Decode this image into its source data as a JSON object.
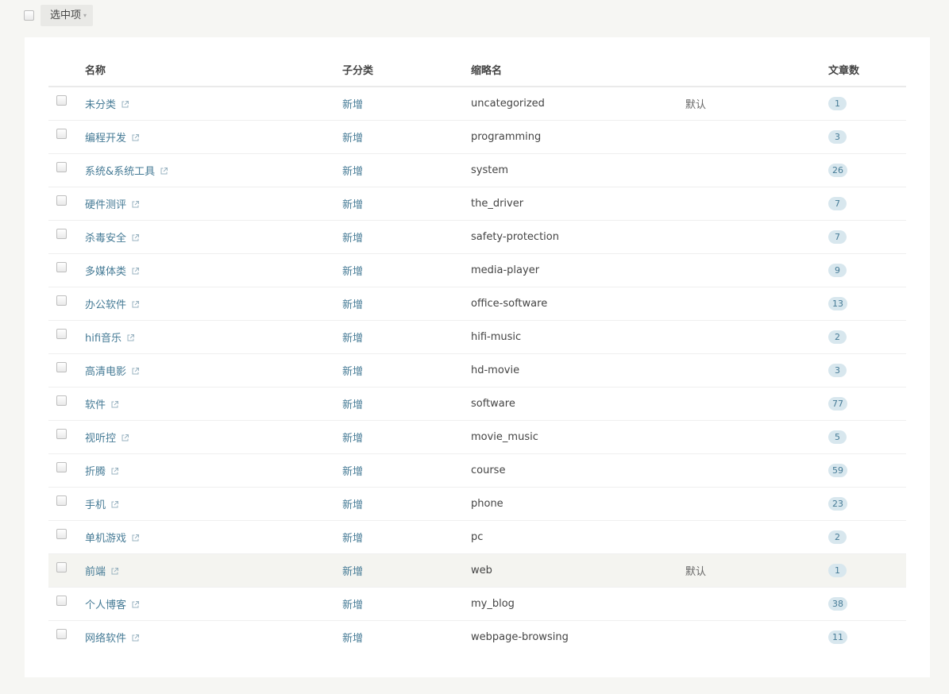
{
  "toolbar": {
    "bulk_label": "选中项",
    "caret": "▾"
  },
  "table": {
    "headers": {
      "name": "名称",
      "sub": "子分类",
      "slug": "缩略名",
      "default": "",
      "count": "文章数"
    },
    "rows": [
      {
        "name": "未分类",
        "add": "新增",
        "slug": "uncategorized",
        "default": "默认",
        "count": "1"
      },
      {
        "name": "编程开发",
        "add": "新增",
        "slug": "programming",
        "default": "",
        "count": "3"
      },
      {
        "name": "系统&系统工具",
        "add": "新增",
        "slug": "system",
        "default": "",
        "count": "26"
      },
      {
        "name": "硬件测评",
        "add": "新增",
        "slug": "the_driver",
        "default": "",
        "count": "7"
      },
      {
        "name": "杀毒安全",
        "add": "新增",
        "slug": "safety-protection",
        "default": "",
        "count": "7"
      },
      {
        "name": "多媒体类",
        "add": "新增",
        "slug": "media-player",
        "default": "",
        "count": "9"
      },
      {
        "name": "办公软件",
        "add": "新增",
        "slug": "office-software",
        "default": "",
        "count": "13"
      },
      {
        "name": "hifi音乐",
        "add": "新增",
        "slug": "hifi-music",
        "default": "",
        "count": "2"
      },
      {
        "name": "高清电影",
        "add": "新增",
        "slug": "hd-movie",
        "default": "",
        "count": "3"
      },
      {
        "name": "软件",
        "add": "新增",
        "slug": "software",
        "default": "",
        "count": "77"
      },
      {
        "name": "视听控",
        "add": "新增",
        "slug": "movie_music",
        "default": "",
        "count": "5"
      },
      {
        "name": "折腾",
        "add": "新增",
        "slug": "course",
        "default": "",
        "count": "59"
      },
      {
        "name": "手机",
        "add": "新增",
        "slug": "phone",
        "default": "",
        "count": "23"
      },
      {
        "name": "单机游戏",
        "add": "新增",
        "slug": "pc",
        "default": "",
        "count": "2"
      },
      {
        "name": "前端",
        "add": "新增",
        "slug": "web",
        "default": "默认",
        "count": "1",
        "highlighted": true
      },
      {
        "name": "个人博客",
        "add": "新增",
        "slug": "my_blog",
        "default": "",
        "count": "38"
      },
      {
        "name": "网络软件",
        "add": "新增",
        "slug": "webpage-browsing",
        "default": "",
        "count": "11"
      }
    ]
  },
  "colors": {
    "link": "#467b96",
    "badge_bg": "#d8e7ee",
    "page_bg": "#f6f6f3",
    "panel_bg": "#ffffff",
    "highlight_row": "#f4f4f0"
  },
  "icons": {
    "external_link": "external-link-icon",
    "dropdown": "caret-down-icon"
  }
}
